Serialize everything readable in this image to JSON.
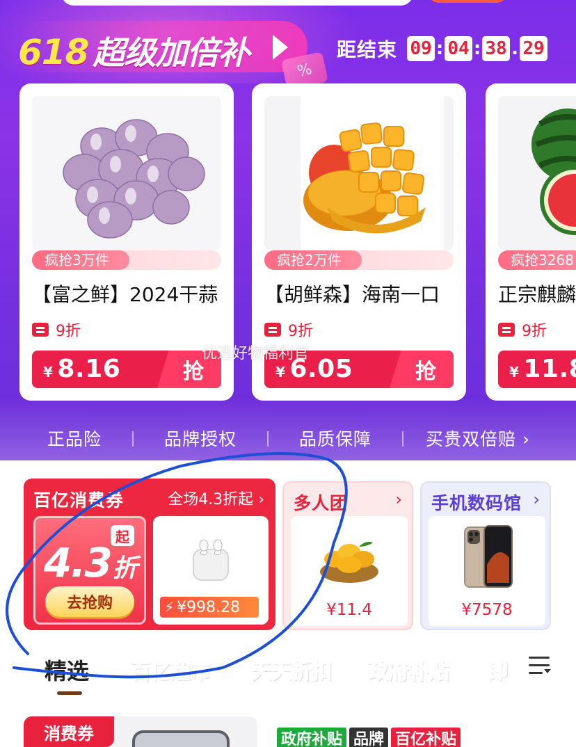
{
  "promo": {
    "banner_number": "618",
    "banner_title": "超级加倍补",
    "countdown_label": "距结束",
    "countdown": [
      "09",
      "04",
      "38",
      "29"
    ],
    "overlay_text": "优选好物福利官",
    "cards": [
      {
        "sold": "疯抢3万件",
        "title": "【富之鲜】2024干蒜",
        "discount": "9折",
        "currency": "¥",
        "price": "8.16",
        "grab": "抢"
      },
      {
        "sold": "疯抢2万件",
        "title": "【胡鲜森】海南一口",
        "discount": "9折",
        "currency": "¥",
        "price": "6.05",
        "grab": "抢"
      },
      {
        "sold": "疯抢3268",
        "title": "正宗麒麟",
        "discount": "9折",
        "currency": "¥",
        "price": "11.8"
      }
    ],
    "guarantees": [
      "正品险",
      "品牌授权",
      "品质保障",
      "买贵双倍赔"
    ],
    "guarantee_chevron": "›"
  },
  "coupon": {
    "title": "百亿消费券",
    "subtitle": "全场4.3折起",
    "chevron": "›",
    "qi": "起",
    "big_number": "4.3",
    "big_unit": "折",
    "go_button": "去抢购",
    "product_price": "¥998.28"
  },
  "mini_cards": [
    {
      "title": "多人团",
      "chevron": "›",
      "price": "¥11.4"
    },
    {
      "title": "手机数码馆",
      "chevron": "›",
      "price": "¥7578"
    }
  ],
  "tabs": [
    {
      "label": "精选",
      "color": "#222222"
    },
    {
      "label": "百亿超市",
      "color": "#e8213c"
    },
    {
      "label": "天天折扣",
      "color": "#ff3b30"
    },
    {
      "label": "政府补贴",
      "color": "#1fa83c"
    },
    {
      "label": "即",
      "color": "#f06aa0"
    }
  ],
  "bottom": {
    "coupon_tag": "消费券",
    "badges": [
      {
        "label": "政府补贴",
        "bg": "#1fa83c",
        "fg": "#ffffff"
      },
      {
        "label": "品牌",
        "bg": "#333333",
        "fg": "#ffffff"
      },
      {
        "label": "百亿补贴",
        "bg": "#e8213c",
        "fg": "#ffffff"
      }
    ]
  },
  "colors": {
    "accent_red": "#e8213c",
    "promo_purple": "#7b2ee9"
  }
}
